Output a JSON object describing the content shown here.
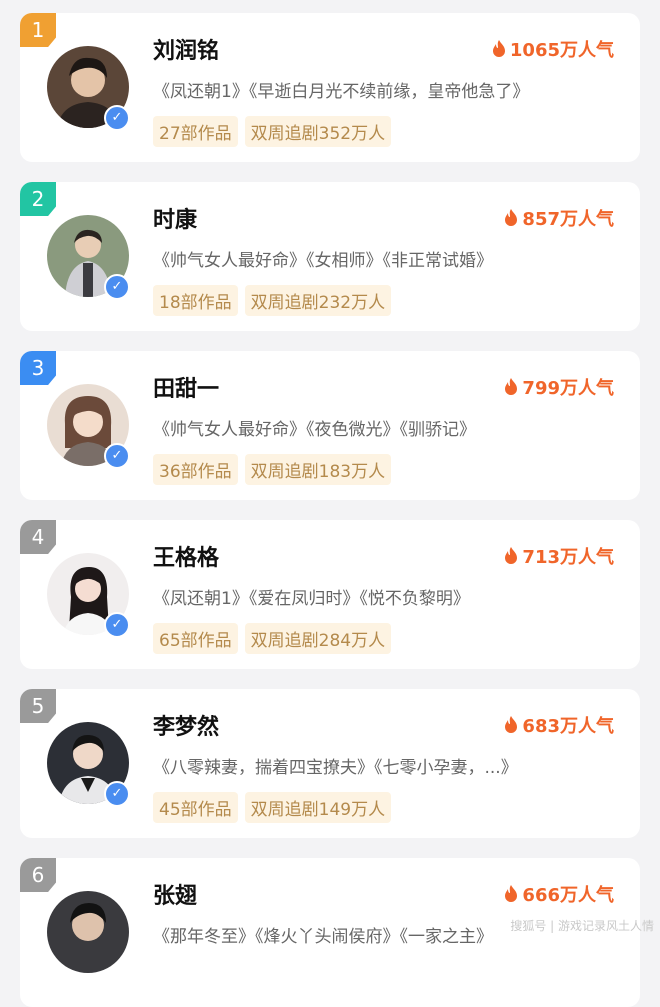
{
  "colors": {
    "rank1": "#f0a032",
    "rank2": "#22c5a3",
    "rank3": "#3b8df2",
    "rank_other": "#9a9a9a",
    "popularity": "#f0652a",
    "tag_bg": "#fdf3e2",
    "tag_text": "#b48a4c"
  },
  "items": [
    {
      "rank": "1",
      "name": "刘润铭",
      "popularity": "1065万人气",
      "works": "《凤还朝1》《早逝白月光不续前缘，皇帝他急了》",
      "count": "27部作品",
      "views": "双周追剧352万人",
      "avatar_icon": "male-portrait-icon"
    },
    {
      "rank": "2",
      "name": "时康",
      "popularity": "857万人气",
      "works": "《帅气女人最好命》《女相师》《非正常试婚》",
      "count": "18部作品",
      "views": "双周追剧232万人",
      "avatar_icon": "male-portrait-icon"
    },
    {
      "rank": "3",
      "name": "田甜一",
      "popularity": "799万人气",
      "works": "《帅气女人最好命》《夜色微光》《驯骄记》",
      "count": "36部作品",
      "views": "双周追剧183万人",
      "avatar_icon": "female-portrait-icon"
    },
    {
      "rank": "4",
      "name": "王格格",
      "popularity": "713万人气",
      "works": "《凤还朝1》《爱在凤归时》《悦不负黎明》",
      "count": "65部作品",
      "views": "双周追剧284万人",
      "avatar_icon": "female-portrait-icon"
    },
    {
      "rank": "5",
      "name": "李梦然",
      "popularity": "683万人气",
      "works": "《八零辣妻，揣着四宝撩夫》《七零小孕妻，...》",
      "count": "45部作品",
      "views": "双周追剧149万人",
      "avatar_icon": "male-portrait-icon"
    },
    {
      "rank": "6",
      "name": "张翅",
      "popularity": "666万人气",
      "works": "《那年冬至》《烽火丫头闹侯府》《一家之主》",
      "count": "",
      "views": "",
      "avatar_icon": "male-portrait-icon"
    }
  ],
  "watermark": "搜狐号 | 游戏记录风土人情"
}
